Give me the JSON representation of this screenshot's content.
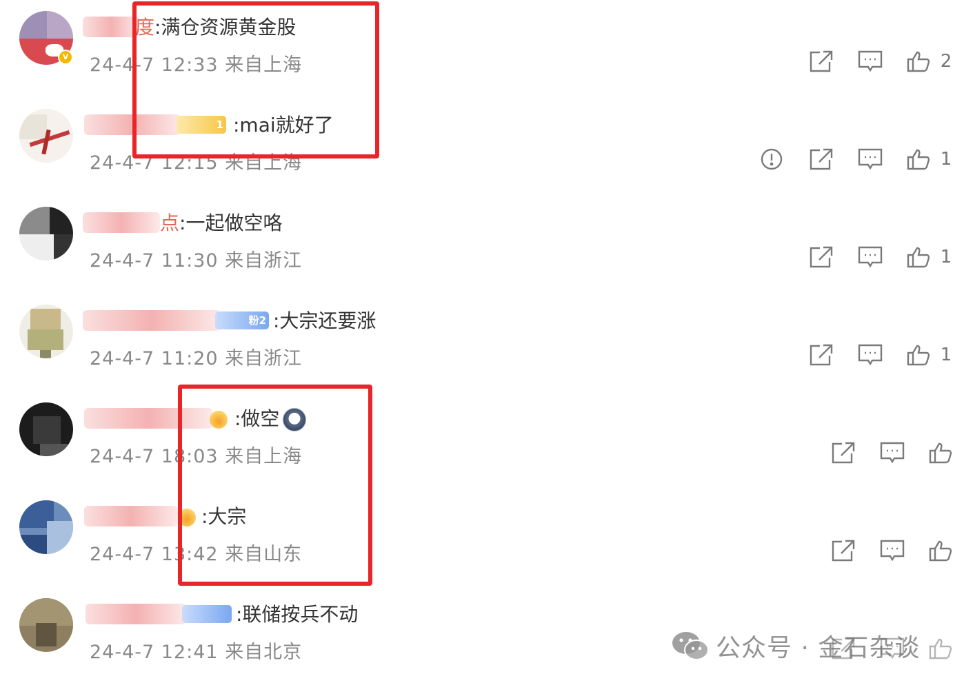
{
  "comments": [
    {
      "text": "满仓资源黄金股",
      "name_tail": "度",
      "time": "24-4-7 12:33",
      "location": "来自上海",
      "likes": "2"
    },
    {
      "text": ":mai就好了",
      "time": "24-4-7 12:15",
      "location": "来自上海",
      "likes": "1"
    },
    {
      "text": "一起做空咯",
      "name_tail": "点",
      "time": "24-4-7 11:30",
      "location": "来自浙江",
      "likes": "1"
    },
    {
      "text": ":大宗还要涨",
      "medal": "粉2",
      "time": "24-4-7 11:20",
      "location": "来自浙江",
      "likes": "1"
    },
    {
      "text": ":做空",
      "time": "24-4-7 18:03",
      "location": "来自上海",
      "likes": ""
    },
    {
      "text": ":大宗",
      "time": "24-4-7 13:42",
      "location": "来自山东",
      "likes": ""
    },
    {
      "text": ":联储按兵不动",
      "time": "24-4-7 12:41",
      "location": "来自北京",
      "likes": ""
    }
  ],
  "watermark": {
    "text": "公众号 · 金石杂谈"
  },
  "colors": {
    "highlight_box": "#e8262a",
    "meta_text": "#888888",
    "icon_stroke": "#7a7a7a"
  }
}
